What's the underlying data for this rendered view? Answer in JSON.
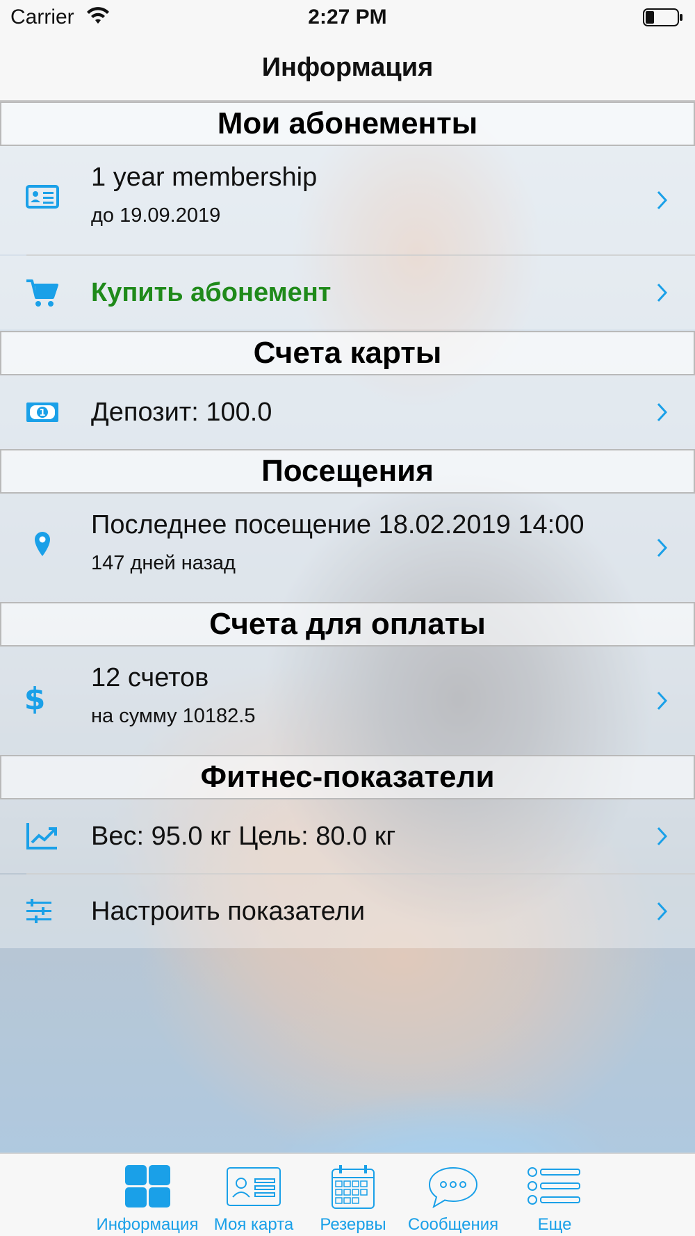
{
  "status_bar": {
    "carrier": "Carrier",
    "time": "2:27 PM"
  },
  "nav": {
    "title": "Информация"
  },
  "colors": {
    "accent": "#1aa0e8",
    "green": "#1f8a1a"
  },
  "sections": {
    "subscriptions": {
      "header": "Мои абонементы",
      "membership": {
        "title": "1 year membership",
        "subtitle": "до 19.09.2019",
        "icon": "id-card-icon"
      },
      "buy": {
        "title": "Купить абонемент",
        "icon": "cart-icon"
      }
    },
    "card_accounts": {
      "header": "Счета карты",
      "deposit": {
        "title": "Депозит: 100.0",
        "icon": "money-icon"
      }
    },
    "visits": {
      "header": "Посещения",
      "last_visit": {
        "title": "Последнее посещение 18.02.2019 14:00",
        "subtitle": "147 дней назад",
        "icon": "location-pin-icon"
      }
    },
    "invoices": {
      "header": "Счета для оплаты",
      "bills": {
        "title": "12 счетов",
        "subtitle": "на сумму 10182.5",
        "icon": "dollar-icon"
      }
    },
    "fitness": {
      "header": "Фитнес-показатели",
      "weight": {
        "title": "Вес: 95.0 кг Цель: 80.0 кг",
        "icon": "chart-line-icon"
      },
      "settings": {
        "title": "Настроить показатели",
        "icon": "sliders-icon"
      }
    }
  },
  "tab_bar": {
    "tabs": [
      {
        "label": "Информация",
        "icon": "grid-icon",
        "selected": true
      },
      {
        "label": "Моя карта",
        "icon": "id-card-icon",
        "selected": false
      },
      {
        "label": "Резервы",
        "icon": "calendar-icon",
        "selected": false
      },
      {
        "label": "Сообщения",
        "icon": "chat-bubble-icon",
        "selected": false
      },
      {
        "label": "Еще",
        "icon": "list-icon",
        "selected": false
      }
    ]
  }
}
